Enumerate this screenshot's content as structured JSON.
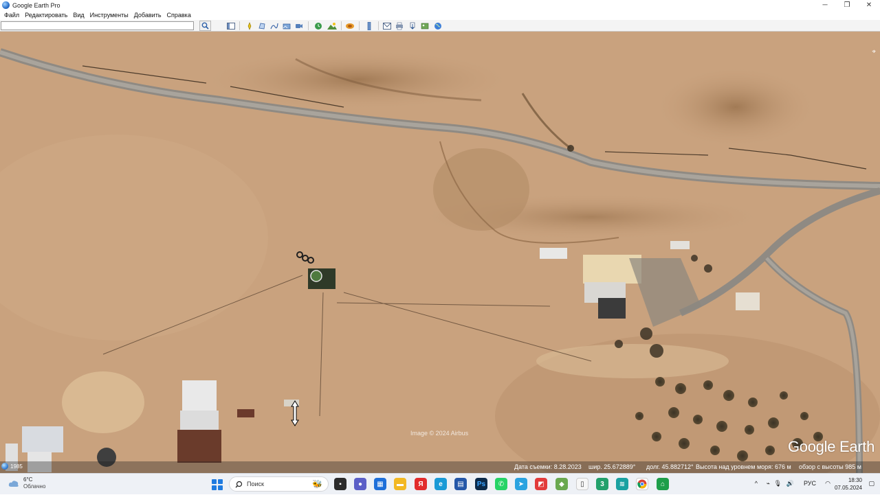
{
  "window": {
    "title": "Google Earth Pro",
    "controls": [
      "─",
      "❐",
      "✕"
    ]
  },
  "menu": {
    "items": [
      "Файл",
      "Редактировать",
      "Вид",
      "Инструменты",
      "Добавить",
      "Справка"
    ]
  },
  "toolbar": {
    "search_value": "",
    "search_placeholder": ""
  },
  "map": {
    "imagery_credit": "Image © 2024 Airbus",
    "watermark": "Google Earth",
    "status": {
      "year": "1985",
      "capture_date": "Дата съемки: 8.28.2023",
      "latitude": "шир.   25.672889°",
      "longitude": "долг.   45.882712°",
      "elevation": "Высота над уровнем моря:   676 м",
      "eye_altitude": "обзор с высоты   985 м"
    }
  },
  "taskbar": {
    "weather_temp": "6°C",
    "weather_desc": "Облачно",
    "search_label": "Поиск",
    "tray_lang": "РУС",
    "time": "18:30",
    "date": "07.05.2024"
  },
  "colors": {
    "terrain": "#c9a27e",
    "road": "#8f8a83",
    "status_bar": "#1e1e1e"
  }
}
